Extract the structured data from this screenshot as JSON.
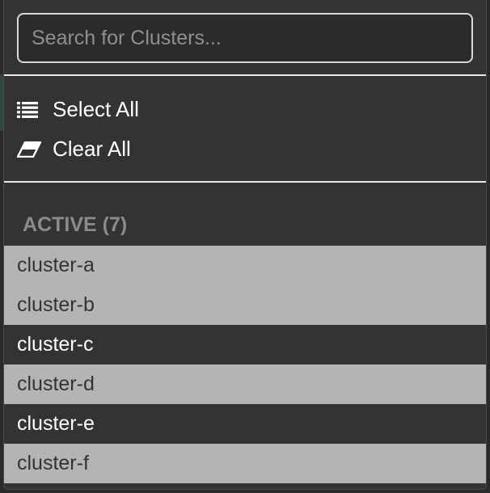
{
  "search": {
    "placeholder": "Search for Clusters...",
    "value": ""
  },
  "actions": {
    "select_all_label": "Select All",
    "select_all_icon": "list-icon",
    "clear_all_label": "Clear All",
    "clear_all_icon": "eraser-icon"
  },
  "group": {
    "header": "ACTIVE (7)"
  },
  "clusters": [
    {
      "label": "cluster-a",
      "selected": true
    },
    {
      "label": "cluster-b",
      "selected": true
    },
    {
      "label": "cluster-c",
      "selected": false
    },
    {
      "label": "cluster-d",
      "selected": true
    },
    {
      "label": "cluster-e",
      "selected": false
    },
    {
      "label": "cluster-f",
      "selected": true
    }
  ],
  "colors": {
    "panel_background": "#333333",
    "selected_row": "#b4b4b4",
    "divider": "#e9e9e9",
    "group_header_text": "#8b8b8b"
  }
}
